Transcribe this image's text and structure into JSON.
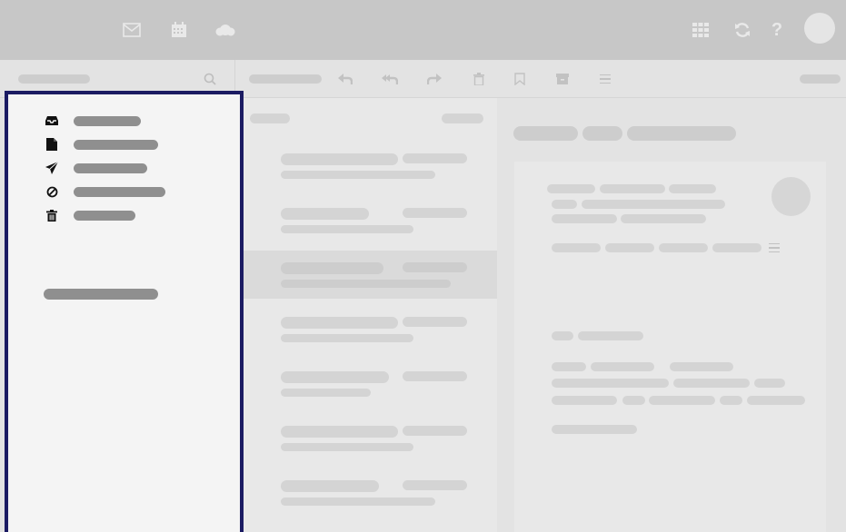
{
  "topbar": {
    "left_icons": [
      "mail-icon",
      "calendar-icon",
      "cloud-icon"
    ],
    "right_icons": [
      "apps-grid-icon",
      "refresh-icon",
      "help-icon"
    ]
  },
  "toolbar": {
    "icons": [
      "search-icon",
      "reply-icon",
      "reply-all-icon",
      "forward-icon",
      "trash-icon",
      "bookmark-icon",
      "archive-icon",
      "menu-icon"
    ]
  },
  "sidebar": {
    "folders": [
      {
        "icon": "inbox-icon"
      },
      {
        "icon": "drafts-icon"
      },
      {
        "icon": "sent-icon"
      },
      {
        "icon": "spam-icon"
      },
      {
        "icon": "trash-icon"
      }
    ]
  },
  "message_list": {
    "selected_index": 2
  },
  "colors": {
    "highlight_border": "#1b1b62",
    "topbar": "#c7c7c7",
    "sidebar_bg": "#f4f4f4",
    "placeholder": "#8f8f8f"
  }
}
